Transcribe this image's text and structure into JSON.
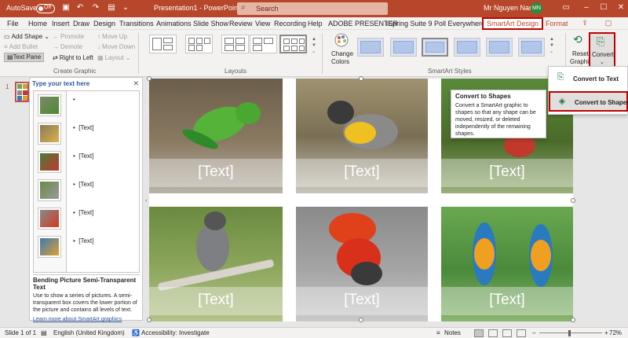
{
  "titlebar": {
    "autosave_label": "AutoSave",
    "autosave_state": "Off",
    "doc_title": "Presentation1 - PowerPoint",
    "search_placeholder": "Search",
    "user_name": "Mr Nguyen Nam",
    "user_initials": "MN"
  },
  "tabs": [
    "File",
    "Home",
    "Insert",
    "Draw",
    "Design",
    "Transitions",
    "Animations",
    "Slide Show",
    "Review",
    "View",
    "Recording",
    "Help",
    "ADOBE PRESENTER",
    "iSpring Suite 9",
    "Poll Everywhere",
    "SmartArt Design",
    "Format"
  ],
  "active_tab": "SmartArt Design",
  "ribbon": {
    "create_graphic": {
      "add_shape": "Add Shape",
      "add_bullet": "Add Bullet",
      "text_pane": "Text Pane",
      "promote": "Promote",
      "demote": "Demote",
      "right_to_left": "Right to Left",
      "move_up": "Move Up",
      "move_down": "Move Down",
      "layout": "Layout",
      "group_label": "Create Graphic"
    },
    "layouts": {
      "group_label": "Layouts"
    },
    "change_colors": {
      "line1": "Change",
      "line2": "Colors"
    },
    "smartart_styles": {
      "group_label": "SmartArt Styles"
    },
    "reset": {
      "line1": "Reset",
      "line2": "Graphic"
    },
    "convert": {
      "label": "Convert"
    }
  },
  "convert_menu": {
    "items": [
      "Convert to Text",
      "Convert to Shapes"
    ],
    "highlighted": "Convert to Shapes"
  },
  "tooltip": {
    "title": "Convert to Shapes",
    "body": "Convert a SmartArt graphic to shapes so that any shape can be moved, resized, or deleted independently of the remaining shapes."
  },
  "slides_panel": {
    "slide_number": "1"
  },
  "text_pane": {
    "title": "Type your text here",
    "bullets": [
      "",
      "[Text]",
      "[Text]",
      "[Text]",
      "[Text]",
      "[Text]"
    ],
    "layout_name": "Bending Picture Semi-Transparent Text",
    "layout_desc": "Use to show a series of pictures. A semi-transparent box covers the lower portion of the picture and contains all levels of text.",
    "learn_more": "Learn more about SmartArt graphics"
  },
  "slide": {
    "captions": [
      "[Text]",
      "[Text]",
      "[Text]",
      "[Text]",
      "[Text]",
      "[Text]"
    ]
  },
  "statusbar": {
    "slide_info": "Slide 1 of 1",
    "language": "English (United Kingdom)",
    "accessibility": "Accessibility: Investigate",
    "notes": "Notes",
    "zoom": "72%"
  },
  "colors": {
    "brand": "#b7472a",
    "highlight_border": "#c00000"
  }
}
